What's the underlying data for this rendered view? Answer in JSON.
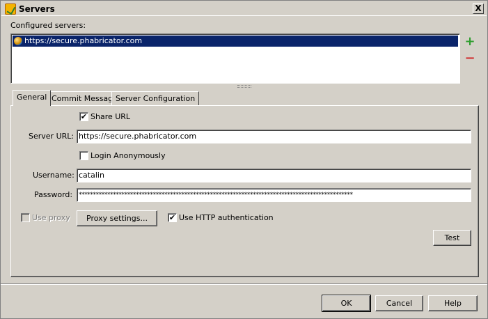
{
  "window": {
    "title": "Servers",
    "close_label": "X"
  },
  "configured_servers_label": "Configured servers:",
  "servers": [
    {
      "url": "https://secure.phabricator.com",
      "selected": true
    }
  ],
  "list_actions": {
    "add": "+",
    "remove": "−"
  },
  "tabs": [
    {
      "label": "General",
      "active": true
    },
    {
      "label": "Commit Message",
      "active": false
    },
    {
      "label": "Server Configuration",
      "active": false
    }
  ],
  "general": {
    "share_url": {
      "label": "Share URL",
      "checked": true,
      "mark": "✔"
    },
    "server_url": {
      "label": "Server URL:",
      "value": "https://secure.phabricator.com"
    },
    "login_anonymously": {
      "label": "Login Anonymously",
      "checked": false
    },
    "username": {
      "label": "Username:",
      "value": "catalin"
    },
    "password": {
      "label": "Password:",
      "value": "************************************************************************************************"
    },
    "use_proxy": {
      "label": "Use proxy",
      "checked": false,
      "enabled": false
    },
    "proxy_settings_button": "Proxy settings...",
    "use_http_auth": {
      "label": "Use HTTP authentication",
      "checked": true,
      "mark": "✔"
    },
    "test_button": "Test"
  },
  "footer": {
    "ok": "OK",
    "cancel": "Cancel",
    "help": "Help"
  },
  "colors": {
    "selection": "#0a246a",
    "dialog_bg": "#d4d0c8",
    "add": "#2e9e2e",
    "remove": "#d03030"
  },
  "icons": [
    "app-icon",
    "globe-icon",
    "add-icon",
    "remove-icon",
    "checkmark-icon"
  ]
}
